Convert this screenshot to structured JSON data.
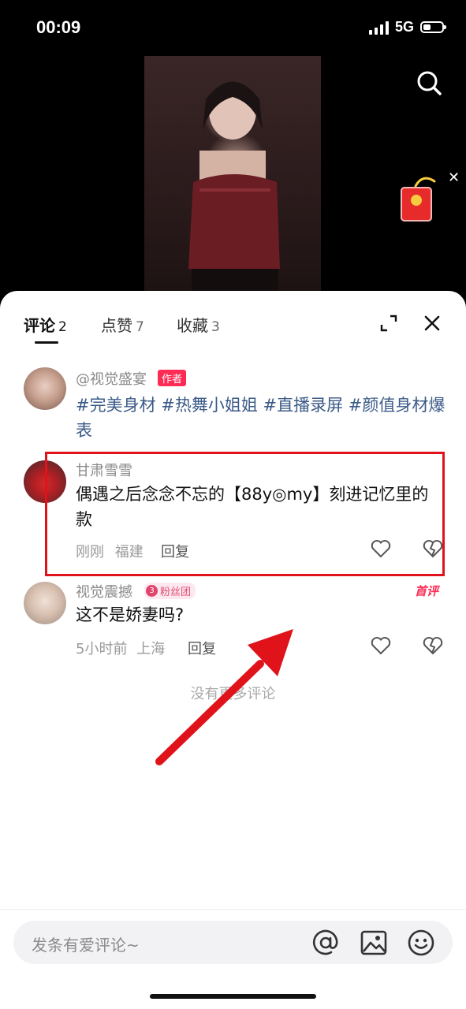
{
  "status_bar": {
    "time": "00:09",
    "network": "5G"
  },
  "tabs": [
    {
      "label": "评论",
      "count": "2",
      "active": true
    },
    {
      "label": "点赞",
      "count": "7",
      "active": false
    },
    {
      "label": "收藏",
      "count": "3",
      "active": false
    }
  ],
  "comments": [
    {
      "username": "@视觉盛宴",
      "tag": "作者",
      "text": "#完美身材 #热舞小姐姐 #直播录屏 #颜值身材爆表"
    },
    {
      "username": "甘肃雪雪",
      "text": "偶遇之后念念不忘的【88y◎my】刻进记忆里的款",
      "time": "刚刚",
      "location": "福建",
      "reply_label": "回复"
    },
    {
      "username": "视觉震撼",
      "fan_badge_level": "3",
      "fan_badge_text": "粉丝团",
      "first_label": "首评",
      "text": "这不是娇妻吗?",
      "time": "5小时前",
      "location": "上海",
      "reply_label": "回复"
    }
  ],
  "no_more_text": "没有更多评论",
  "input": {
    "placeholder": "发条有爱评论~"
  },
  "icons": [
    "search-icon",
    "red-packet-icon",
    "close-icon",
    "expand-icon",
    "heart-icon",
    "dislike-heart-icon",
    "at-icon",
    "image-icon",
    "emoji-icon"
  ],
  "colors": {
    "accent": "#fe2c55",
    "hashtag": "#3a5a88",
    "highlight": "#e0131b"
  }
}
